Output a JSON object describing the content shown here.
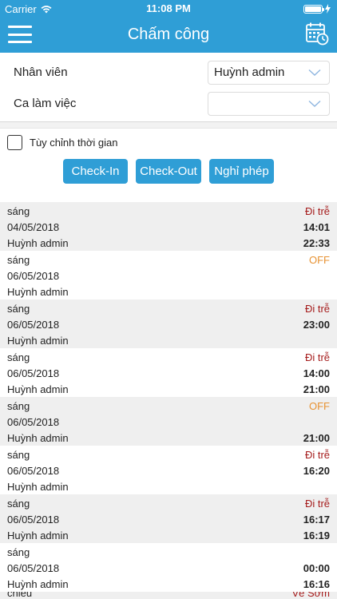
{
  "status_bar": {
    "carrier": "Carrier",
    "time": "11:08 PM"
  },
  "navbar": {
    "title": "Chấm công",
    "menu_icon": "hamburger-menu-icon",
    "calendar_icon": "calendar-clock-icon"
  },
  "form": {
    "employee_label": "Nhân viên",
    "employee_value": "Huỳnh admin",
    "shift_label": "Ca làm việc",
    "shift_value": ""
  },
  "custom_time": {
    "label": "Tùy chỉnh thời gian",
    "checked": false
  },
  "actions": {
    "check_in": "Check-In",
    "check_out": "Check-Out",
    "leave": "Nghỉ phép"
  },
  "colors": {
    "primary": "#2f9ed6",
    "late": "#a51b1b",
    "off": "#e79232",
    "row_shade": "#efefef"
  },
  "records": [
    {
      "shift": "sáng",
      "date": "04/05/2018",
      "name": "Huỳnh admin",
      "status": "Đi trễ",
      "status_type": "late",
      "time_in": "14:01",
      "time_out": "22:33"
    },
    {
      "shift": "sáng",
      "date": "06/05/2018",
      "name": "Huỳnh admin",
      "status": "OFF",
      "status_type": "off",
      "time_in": "",
      "time_out": ""
    },
    {
      "shift": "sáng",
      "date": "06/05/2018",
      "name": "Huỳnh admin",
      "status": "Đi trễ",
      "status_type": "late",
      "time_in": "23:00",
      "time_out": ""
    },
    {
      "shift": "sáng",
      "date": "06/05/2018",
      "name": "Huỳnh admin",
      "status": "Đi trễ",
      "status_type": "late",
      "time_in": "14:00",
      "time_out": "21:00"
    },
    {
      "shift": "sáng",
      "date": "06/05/2018",
      "name": "Huỳnh admin",
      "status": "OFF",
      "status_type": "off",
      "time_in": "",
      "time_out": "21:00"
    },
    {
      "shift": "sáng",
      "date": "06/05/2018",
      "name": "Huỳnh admin",
      "status": "Đi trễ",
      "status_type": "late",
      "time_in": "16:20",
      "time_out": ""
    },
    {
      "shift": "sáng",
      "date": "06/05/2018",
      "name": "Huỳnh admin",
      "status": "Đi trễ",
      "status_type": "late",
      "time_in": "16:17",
      "time_out": "16:19"
    },
    {
      "shift": "sáng",
      "date": "06/05/2018",
      "name": "Huỳnh admin",
      "status": "",
      "status_type": "none",
      "time_in": "00:00",
      "time_out": "16:16"
    },
    {
      "shift": "chiều",
      "date": "",
      "name": "",
      "status": "Về Sớm",
      "status_type": "late",
      "time_in": "",
      "time_out": ""
    }
  ]
}
